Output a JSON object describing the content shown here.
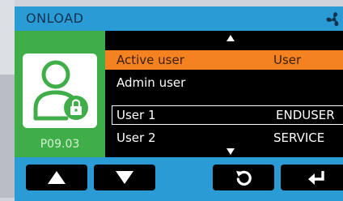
{
  "header": {
    "title": "ONLOAD",
    "icon": "fan-icon"
  },
  "side_panel": {
    "icon": "user-lock-icon",
    "code": "P09.03",
    "color": "#3fae49"
  },
  "list": {
    "rows": [
      {
        "name": "Active user",
        "role": "User"
      },
      {
        "name": "Admin user",
        "role": ""
      },
      {
        "name": "User 1",
        "role": "ENDUSER"
      },
      {
        "name": "User 2",
        "role": "SERVICE"
      }
    ],
    "highlight_color": "#f58220"
  },
  "toolbar": {
    "buttons": [
      {
        "icon": "arrow-up-icon"
      },
      {
        "icon": "arrow-down-icon"
      },
      {
        "icon": "back-icon"
      },
      {
        "icon": "enter-icon"
      }
    ]
  }
}
